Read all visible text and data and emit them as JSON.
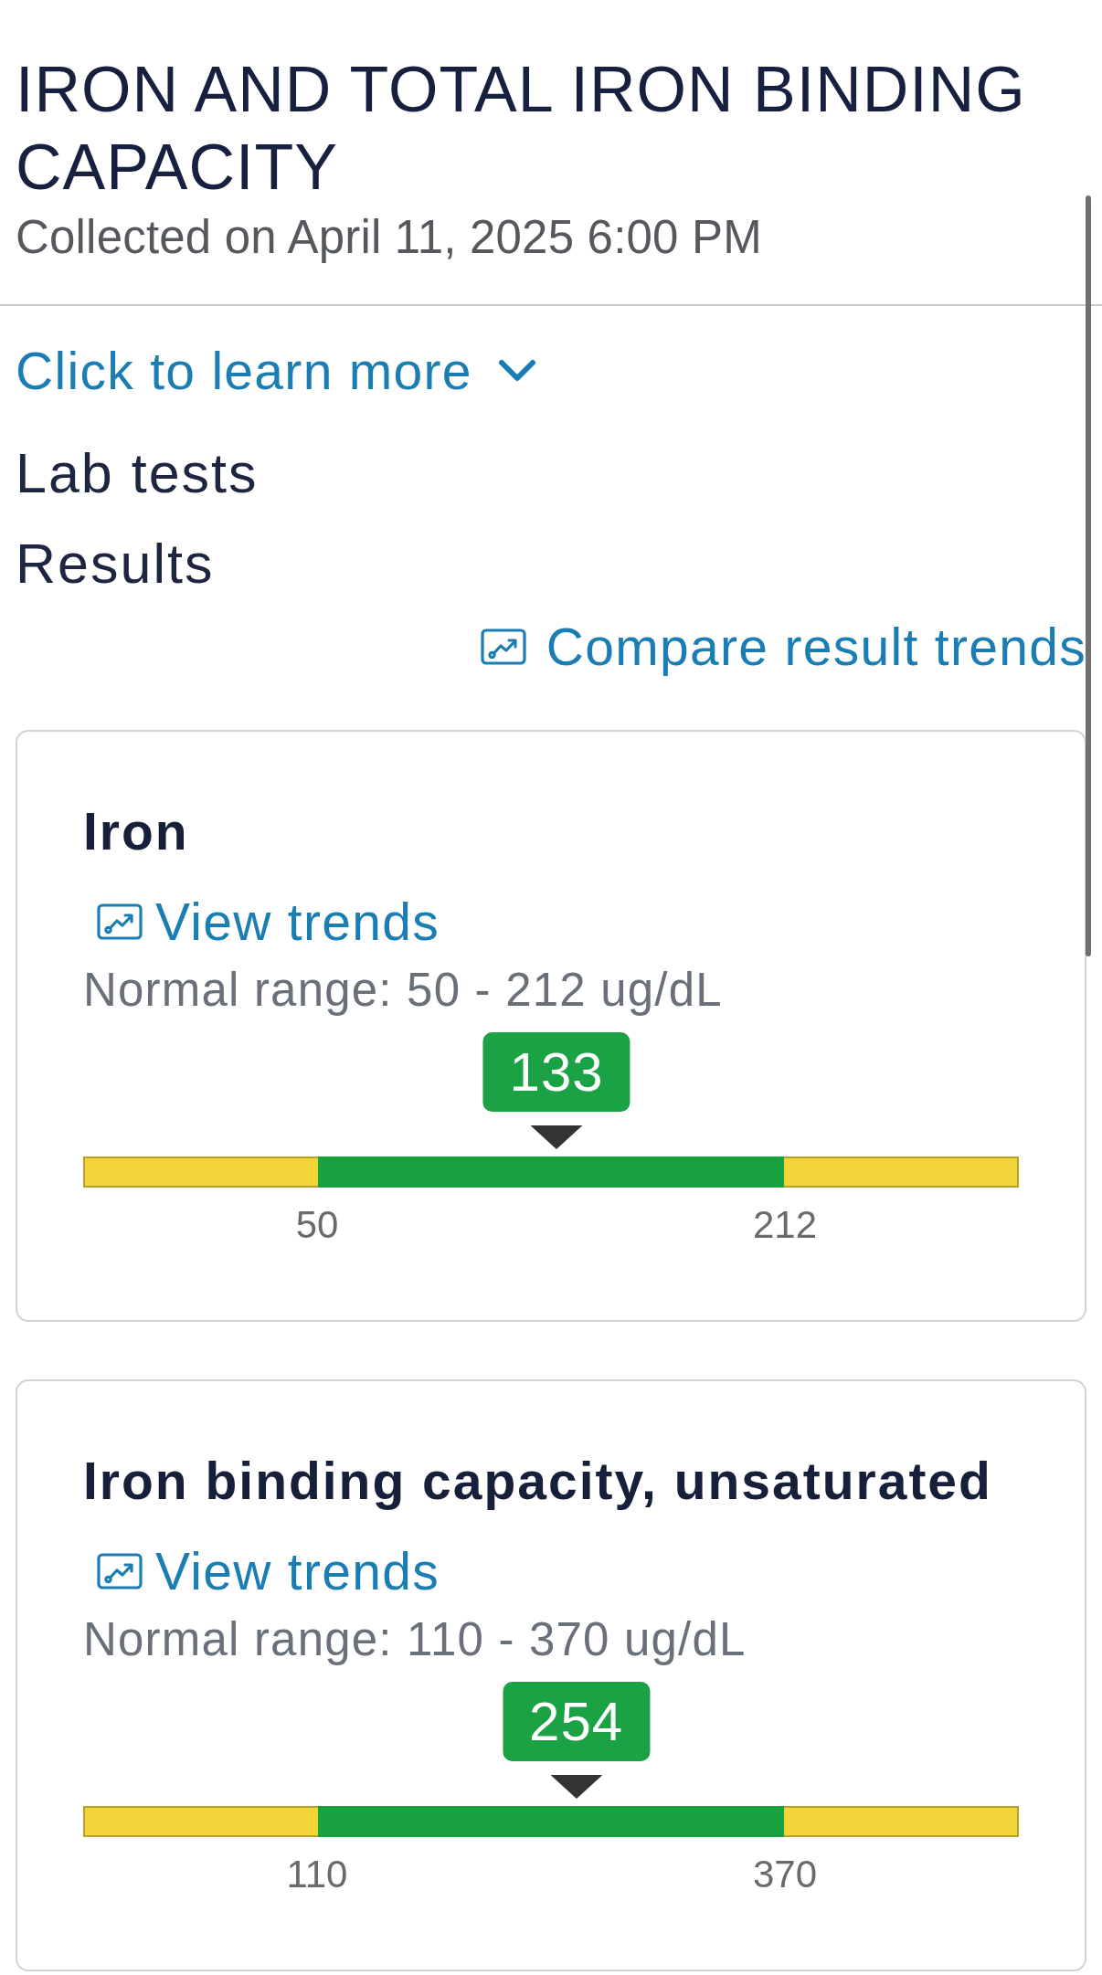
{
  "header": {
    "title": "IRON AND TOTAL IRON BINDING CAPACITY",
    "subtitle": "Collected on April 11, 2025 6:00 PM"
  },
  "learn_more": {
    "label": "Click to learn more",
    "expanded": false
  },
  "headings": [
    "Lab tests",
    "Results"
  ],
  "compare_link": "Compare result trends",
  "results": [
    {
      "name": "Iron",
      "trends_link": "View trends",
      "normal_range": "Normal range: 50 - 212 ug/dL",
      "value": "133",
      "in_range": true,
      "level": 0.506,
      "range_low": "50",
      "range_high": "212"
    },
    {
      "name": "Iron binding capacity, unsaturated",
      "trends_link": "View trends",
      "normal_range": "Normal range: 110 - 370 ug/dL",
      "value": "254",
      "in_range": true,
      "level": 0.527,
      "range_low": "110",
      "range_high": "370"
    }
  ]
}
